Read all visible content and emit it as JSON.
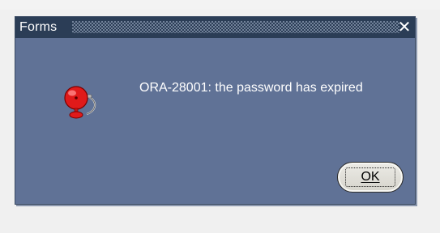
{
  "dialog": {
    "title": "Forms",
    "close_glyph": "✕",
    "message": "ORA-28001: the password has expired",
    "icon": "alarm-bell-icon",
    "ok_label": "OK"
  },
  "colors": {
    "dialog_bg": "#607296",
    "titlebar_bg": "#2b3d56",
    "text": "#ffffff",
    "bell_red": "#e01a1a"
  }
}
